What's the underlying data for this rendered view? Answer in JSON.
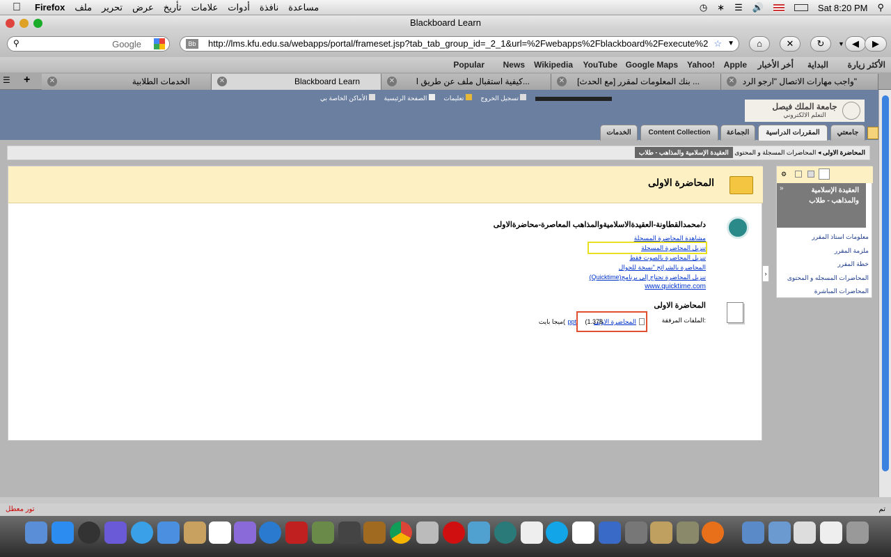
{
  "menubar": {
    "app_name": "Firefox",
    "menus": [
      "ملف",
      "تحرير",
      "عرض",
      "تأريخ",
      "علامات",
      "أدوات",
      "نافذة",
      "مساعدة"
    ],
    "clock": "Sat 8:20 PM"
  },
  "window": {
    "title": "Blackboard Learn"
  },
  "navbar": {
    "search_placeholder": "Google",
    "url": "http://lms.kfu.edu.sa/webapps/portal/frameset.jsp?tab_tab_group_id=_2_1&url=%2Fwebapps%2Fblackboard%2Fexecute%2"
  },
  "bookmarks": [
    "الأكثر زيارة",
    "البداية",
    "أخر الأخبار",
    "Apple",
    "Yahoo!",
    "Google Maps",
    "YouTube",
    "Wikipedia",
    "News",
    "Popular"
  ],
  "tabs": [
    {
      "title": "واجب مهارات الاتصال \"ارجو الرد\""
    },
    {
      "title": "[مع الحدث] بنك المعلومات لمقرر ..."
    },
    {
      "title": "كيفية استقبال ملف عن طريق ا..."
    },
    {
      "title": "Blackboard Learn"
    },
    {
      "title": "الخدمات الطلابية"
    }
  ],
  "bb": {
    "top_links": [
      "الأماكن الخاصة بي",
      "الصفحة الرئيسية",
      "تعليمات",
      "تسجيل الخروج"
    ],
    "logo_line1": "جامعة الملك فيصل",
    "logo_line2": "التعلم الالكتروني",
    "tabs": [
      "جامعتي",
      "المقررات الدراسية",
      "الجماعة",
      "Content Collection",
      "الخدمات"
    ],
    "breadcrumb": {
      "course": "العقيدة الإسلامية والمذاهب - طلاب",
      "section": "المحاضرات المسجلة و المحتوى",
      "current": "المحاضرة الاولى"
    },
    "content_title": "المحاضرة الاولى",
    "item1": {
      "title": "د/محمدالقطاونة-العقيدةالاسلاميةوالمذاهب المعاصرة-محاضرةالاولى",
      "links": [
        "مشاهدة المحاضرة المسجلة",
        "تنزيل المحاضرة المسجلة",
        "تنزيل المحاضرة بالصوت فقط",
        "المحاضرة بالشرائح \"نسخة للجوال",
        "(Quicktime)تنزيل المحاضرة تحتاج إلى برنامج",
        "www.quicktime.com"
      ]
    },
    "item2": {
      "title": "المحاضرة الاولى",
      "attach_label": "الملفات المرفقة:",
      "attach_file": "المحاضرة الاولى",
      "attach_ext": "ppt",
      "attach_size": "(1.378",
      "attach_unit": "ميجا بايت("
    },
    "sidebar": {
      "course": "العقيدة الإسلامية والمذاهب - طلاب",
      "links": [
        "معلومات استاذ المقرر",
        "ملزمة المقرر",
        "خطة المقرر",
        "المحاضرات المسجله و المحتوى",
        "المحاضرات المباشرة"
      ]
    }
  },
  "status": {
    "left": "تور معطل",
    "right": "تم"
  }
}
